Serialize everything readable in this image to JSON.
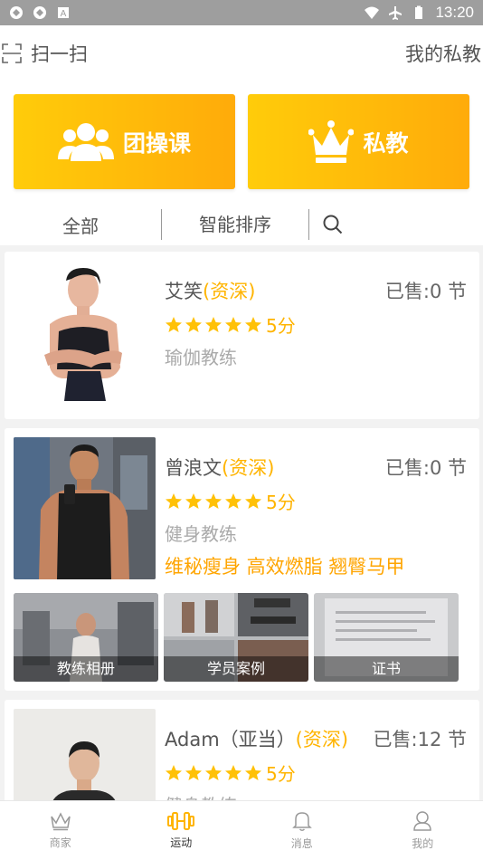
{
  "status_bar": {
    "time": "13:20"
  },
  "topbar": {
    "scan_label": "扫一扫",
    "my_private": "我的私教"
  },
  "big_buttons": [
    {
      "label": "团操课",
      "icon": "group-icon"
    },
    {
      "label": "私教",
      "icon": "crown-icon"
    }
  ],
  "filters": {
    "all": "全部",
    "sort": "智能排序",
    "search_icon": "search-icon"
  },
  "colors": {
    "accent": "#ffb400",
    "gradient_start": "#ffcc0a",
    "gradient_end": "#ffab0a",
    "tag_orange": "#ffa500"
  },
  "coaches": [
    {
      "name": "艾笑",
      "level": "(资深)",
      "sold": "已售:0 节",
      "rating": 5,
      "score": "5分",
      "role": "瑜伽教练"
    },
    {
      "name": "曾浪文",
      "level": "(资深)",
      "sold": "已售:0 节",
      "rating": 5,
      "score": "5分",
      "role": "健身教练",
      "tags": "维秘瘦身 高效燃脂 翘臀马甲",
      "albums": [
        "教练相册",
        "学员案例",
        "证书"
      ]
    },
    {
      "name": "Adam（亚当）",
      "level": "(资深)",
      "sold": "已售:12 节",
      "rating": 5,
      "score": "5分",
      "role": "健身教练"
    }
  ],
  "bottom_nav": [
    {
      "label": "商家",
      "icon": "crown-outline-icon"
    },
    {
      "label": "运动",
      "icon": "dumbbell-icon",
      "active": true
    },
    {
      "label": "消息",
      "icon": "bell-icon"
    },
    {
      "label": "我的",
      "icon": "user-icon"
    }
  ]
}
